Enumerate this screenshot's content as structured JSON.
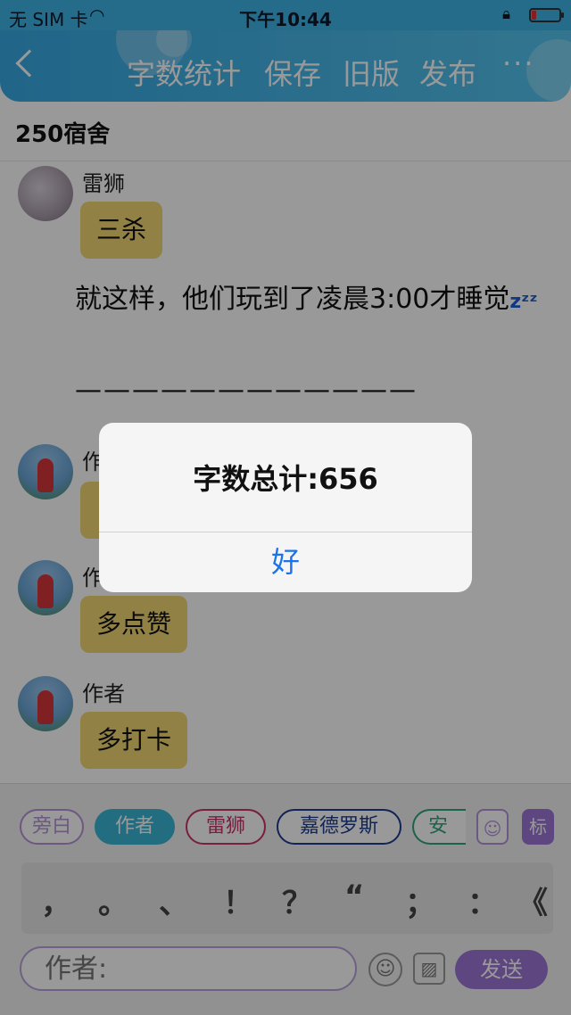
{
  "status_bar": {
    "carrier": "无 SIM 卡",
    "time": "下午10:44"
  },
  "nav": {
    "actions": [
      "字数统计",
      "保存",
      "旧版",
      "发布"
    ],
    "more": "···"
  },
  "room": {
    "title": "250宿舍"
  },
  "messages": [
    {
      "speaker": "雷狮",
      "text": "三杀"
    },
    {
      "speaker": "作",
      "text": ""
    },
    {
      "speaker": "作",
      "text": "多点赞"
    },
    {
      "speaker": "作者",
      "text": "多打卡"
    }
  ],
  "narration": {
    "text": "就这样，他们玩到了凌晨3:00才睡觉",
    "emoji": "zᶻᶻ",
    "divider": "————————————"
  },
  "toolbar": {
    "roles": [
      {
        "label": "旁白",
        "color": "#b493d8",
        "active": false
      },
      {
        "label": "作者",
        "color": "#3bb6d6",
        "active": true
      },
      {
        "label": "雷狮",
        "color": "#c8336a",
        "active": false
      },
      {
        "label": "嘉德罗斯",
        "color": "#1d3d8f",
        "active": false
      },
      {
        "label": "安迷",
        "color": "#2fa37f",
        "active": false
      }
    ],
    "add_role_icon": "person-icon",
    "tag_button": "标",
    "punctuation": [
      "，",
      "。",
      "、",
      "！",
      "？",
      "“",
      "；",
      "：",
      "《"
    ],
    "input_placeholder": "作者:",
    "send_label": "发送"
  },
  "dialog": {
    "message": "字数总计:656",
    "ok_label": "好"
  }
}
